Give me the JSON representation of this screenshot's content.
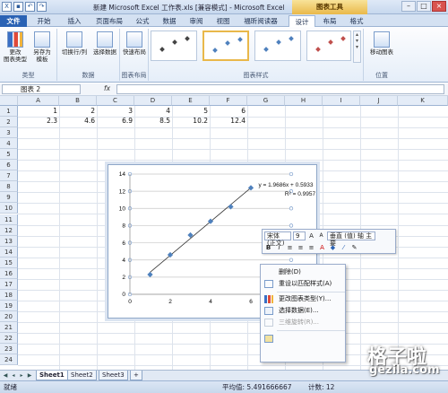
{
  "window": {
    "title": "新建 Microsoft Excel 工作表.xls [兼容模式] - Microsoft Excel",
    "context_tab": "图表工具"
  },
  "tabs": [
    {
      "label": "文件"
    },
    {
      "label": "开始"
    },
    {
      "label": "插入"
    },
    {
      "label": "页面布局"
    },
    {
      "label": "公式"
    },
    {
      "label": "数据"
    },
    {
      "label": "审阅"
    },
    {
      "label": "视图"
    },
    {
      "label": "福昕阅读器"
    },
    {
      "label": "设计"
    },
    {
      "label": "布局"
    },
    {
      "label": "格式"
    }
  ],
  "ribbon": {
    "type_group": {
      "label": "类型",
      "change_chart": "更改\n图表类型",
      "save_template": "另存为\n模板"
    },
    "data_group": {
      "label": "数据",
      "switch_row_col": "切换行/列",
      "select_data": "选择数据"
    },
    "layout_group": {
      "label": "图表布局",
      "quick_layout": "快速布局"
    },
    "styles_group": {
      "label": "图表样式"
    },
    "location_group": {
      "label": "位置",
      "move_chart": "移动图表"
    }
  },
  "formula_bar": {
    "name_box": "图表 2",
    "fx": "fx",
    "value": ""
  },
  "sheet": {
    "columns": [
      "A",
      "B",
      "C",
      "D",
      "E",
      "F",
      "G",
      "H",
      "I",
      "J",
      "K"
    ],
    "rows": [
      "1",
      "2",
      "3",
      "4",
      "5",
      "6",
      "7",
      "8",
      "9",
      "10",
      "11",
      "12",
      "13",
      "14",
      "15",
      "16",
      "17",
      "18",
      "19",
      "20",
      "21",
      "22",
      "23",
      "24"
    ],
    "row1": [
      "1",
      "2",
      "3",
      "4",
      "5",
      "6"
    ],
    "row2": [
      "2.3",
      "4.6",
      "6.9",
      "8.5",
      "10.2",
      "12.4"
    ]
  },
  "chart_data": {
    "type": "scatter",
    "x": [
      1,
      2,
      3,
      4,
      5,
      6
    ],
    "y": [
      2.3,
      4.6,
      6.9,
      8.5,
      10.2,
      12.4
    ],
    "trendline": {
      "slope": 1.9686,
      "intercept": 0.5933
    },
    "trend_equation": "y = 1.9686x + 0.5933",
    "r_squared": "R² = 0.9957",
    "xlim": [
      0,
      8
    ],
    "ylim": [
      0,
      14
    ],
    "x_ticks": [
      "0",
      "2",
      "4",
      "6"
    ],
    "y_ticks": [
      "0",
      "2",
      "4",
      "6",
      "8",
      "10",
      "12",
      "14"
    ],
    "grid": true,
    "marker_color": "#4f81bd"
  },
  "mini_toolbar": {
    "font_name": "宋体 (正文)",
    "font_size": "9",
    "grow": "A",
    "shrink": "A",
    "fill_label": "垂直 (值) 轴 主要",
    "bold": "B",
    "italic": "I"
  },
  "context_menu": {
    "items": [
      {
        "label": "删除(D)",
        "disabled": false
      },
      {
        "label": "重设以匹配样式(A)",
        "disabled": false
      },
      {
        "label": "更改图表类型(Y)...",
        "disabled": false
      },
      {
        "label": "选择数据(E)...",
        "disabled": false
      },
      {
        "label": "三维旋转(R)...",
        "disabled": true
      }
    ]
  },
  "sheet_tabs": [
    "Sheet1",
    "Sheet2",
    "Sheet3"
  ],
  "status": {
    "ready": "就绪",
    "average": "平均值: 5.491666667",
    "count": "计数: 12"
  },
  "watermark": {
    "cn": "格子啦",
    "en": "gezila.com"
  }
}
